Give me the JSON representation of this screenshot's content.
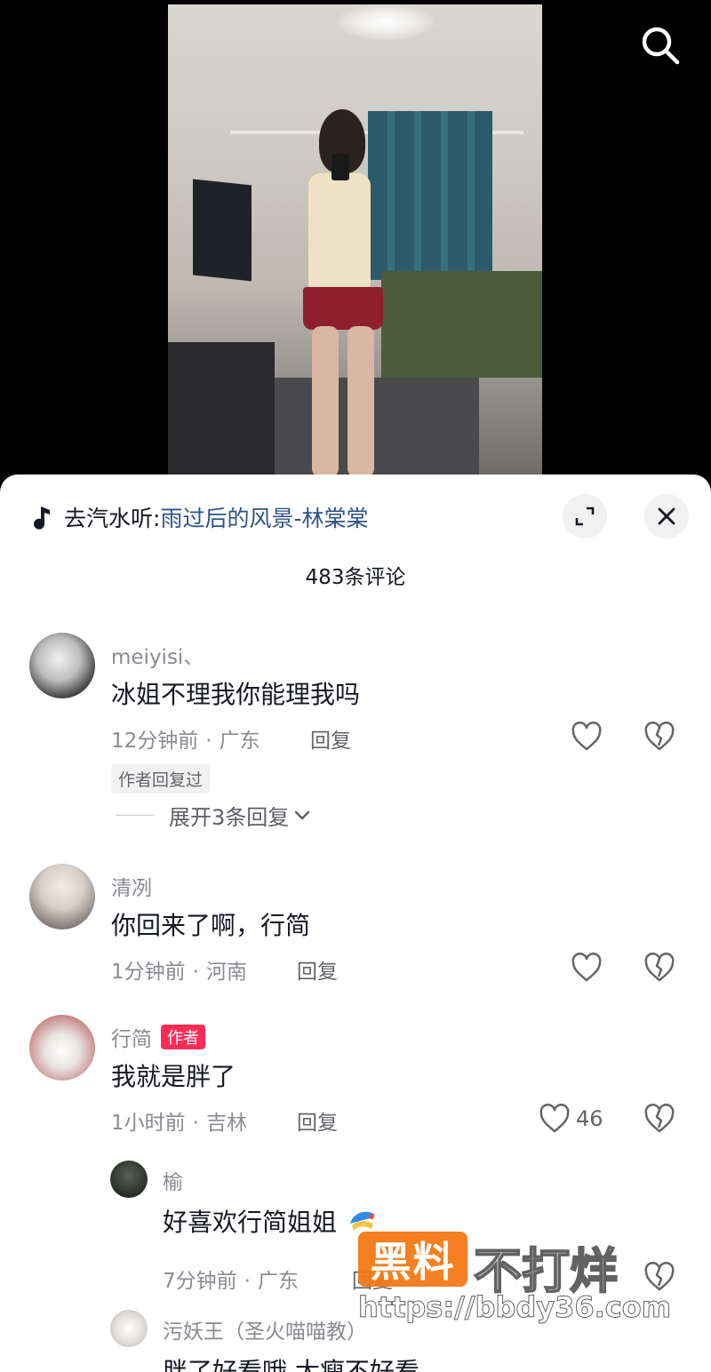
{
  "music": {
    "prefix": "去汽水听: ",
    "song": "雨过后的风景-林棠棠"
  },
  "comment_count": "483条评论",
  "comments": [
    {
      "username": "meiyisi、",
      "text": "冰姐不理我你能理我吗",
      "time": "12分钟前",
      "location": "广东",
      "reply_label": "回复",
      "tag": "作者回复过",
      "expand_label": "展开3条回复"
    },
    {
      "username": "清冽",
      "text": "你回来了啊，行简",
      "time": "1分钟前",
      "location": "河南",
      "reply_label": "回复"
    },
    {
      "username": "行简",
      "badge": "作者",
      "text": "我就是胖了",
      "time": "1小时前",
      "location": "吉林",
      "reply_label": "回复",
      "likes": "46"
    },
    {
      "username": "榆",
      "text": "好喜欢行简姐姐",
      "time": "7分钟前",
      "location": "广东",
      "reply_label": "回复"
    },
    {
      "username": "污妖王（圣火喵喵教）",
      "text": "胖了好看哦            太瘦不好看"
    }
  ],
  "watermark": {
    "box_text": "黑料",
    "text": "不打烊",
    "url": "https://bbdy36.com"
  },
  "icons": {
    "search": "search-icon",
    "music": "music-note-icon",
    "expand": "expand-icon",
    "close": "close-icon",
    "like": "heart-icon",
    "dislike": "broken-heart-icon",
    "chevron": "chevron-down-icon"
  },
  "colors": {
    "author_badge": "#fe2c55",
    "music_link": "#2e5387",
    "meta_gray": "#8a8b91"
  }
}
